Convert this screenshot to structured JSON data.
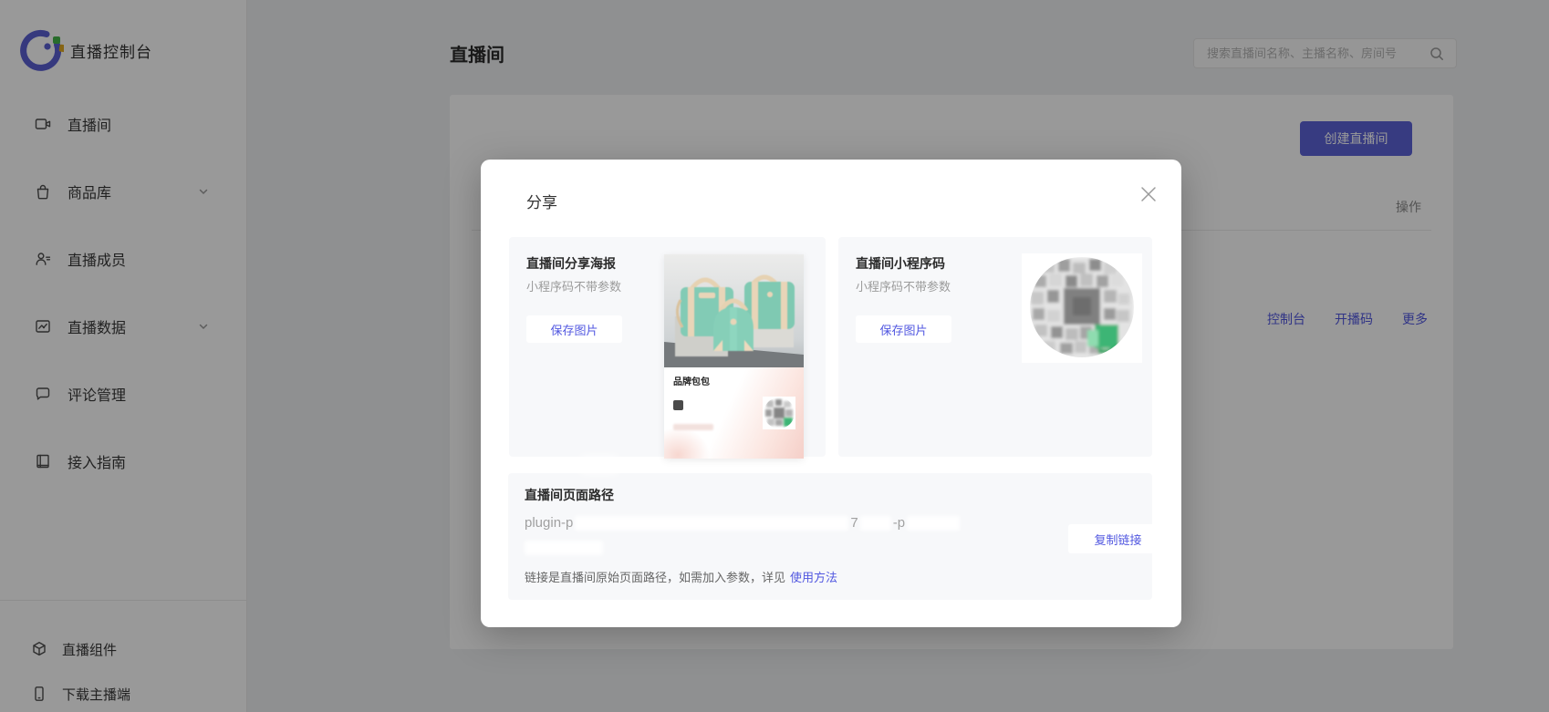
{
  "app_title": "直播控制台",
  "sidebar": {
    "items": [
      {
        "label": "直播间",
        "icon": "live-room-icon",
        "has_arrow": false
      },
      {
        "label": "商品库",
        "icon": "goods-icon",
        "has_arrow": true
      },
      {
        "label": "直播成员",
        "icon": "members-icon",
        "has_arrow": false
      },
      {
        "label": "直播数据",
        "icon": "live-data-icon",
        "has_arrow": true
      },
      {
        "label": "评论管理",
        "icon": "comments-icon",
        "has_arrow": false
      },
      {
        "label": "接入指南",
        "icon": "guide-icon",
        "has_arrow": false
      }
    ],
    "bottom_items": [
      {
        "label": "直播组件",
        "icon": "component-cube-icon"
      },
      {
        "label": "下载主播端",
        "icon": "download-phone-icon"
      }
    ]
  },
  "header": {
    "page_title": "直播间",
    "search_placeholder": "搜索直播间名称、主播名称、房间号"
  },
  "content": {
    "create_button": "创建直播间",
    "table_header_action": "操作",
    "row_actions": [
      "控制台",
      "开播码",
      "更多"
    ]
  },
  "modal": {
    "title": "分享",
    "poster_section": {
      "title": "直播间分享海报",
      "subtitle": "小程序码不带参数",
      "save_button": "保存图片",
      "poster_brand_title": "品牌包包"
    },
    "qrcode_section": {
      "title": "直播间小程序码",
      "subtitle": "小程序码不带参数",
      "save_button": "保存图片"
    },
    "path_section": {
      "title": "直播间页面路径",
      "path_fragments": [
        "plugin-p",
        "7",
        "-p"
      ],
      "copy_button": "复制链接",
      "note_text": "链接是直播间原始页面路径，如需加入参数，详见",
      "note_link": "使用方法"
    }
  },
  "colors": {
    "accent_button": "#5c63d8",
    "link_blue": "#5157e0",
    "qr_green": "#3eb575",
    "poster_teal": "#82cbb5"
  }
}
